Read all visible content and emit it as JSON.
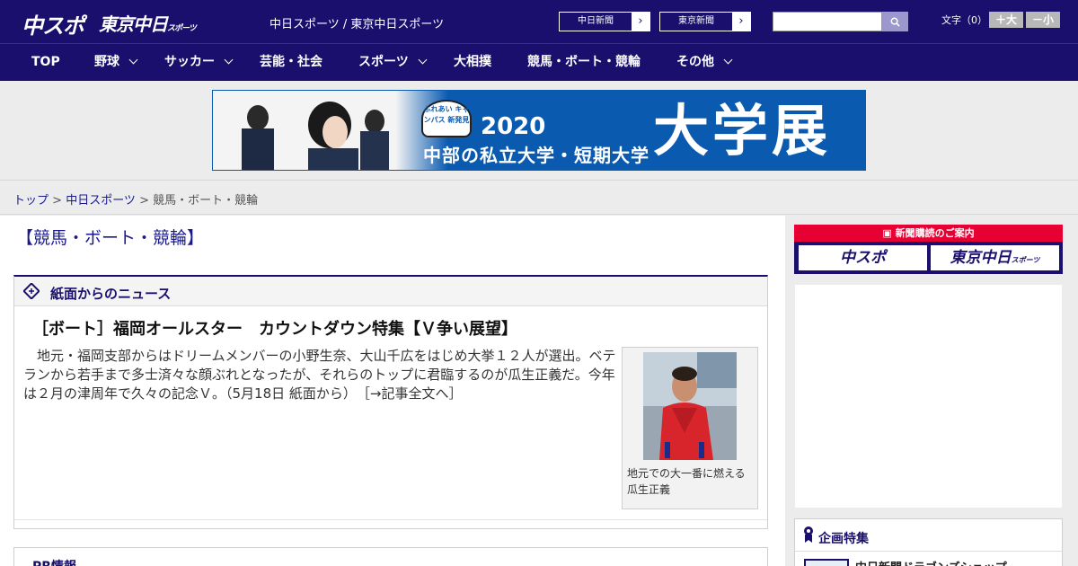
{
  "header": {
    "logo_chuspo": "中スポ",
    "logo_tokyo": "東京中日",
    "logo_tokyo_small": "スポーツ",
    "site_links": "中日スポーツ / 東京中日スポーツ",
    "paper_a": "中日新聞",
    "paper_b": "東京新聞",
    "arrow": "›",
    "search": {
      "value": "",
      "placeholder": ""
    },
    "moji_label": "文字（0）",
    "size_plus": "＋大",
    "size_minus": "－小"
  },
  "nav": {
    "items": [
      {
        "label": "TOP",
        "dropdown": false
      },
      {
        "label": "野球",
        "dropdown": true
      },
      {
        "label": "サッカー",
        "dropdown": true
      },
      {
        "label": "芸能・社会",
        "dropdown": false
      },
      {
        "label": "スポーツ",
        "dropdown": true
      },
      {
        "label": "大相撲",
        "dropdown": false
      },
      {
        "label": "競馬・ボート・競輪",
        "dropdown": false
      },
      {
        "label": "その他",
        "dropdown": true
      }
    ]
  },
  "banner": {
    "badge": "ふれあい キャンパス 新発見",
    "year": "2020",
    "subtitle": "中部の私立大学・短期大学",
    "big": "大学展"
  },
  "breadcrumb": {
    "home": "トップ",
    "sep": " > ",
    "section": "中日スポーツ",
    "current": "競馬・ボート・競輪"
  },
  "page": {
    "title": "【競馬・ボート・競輪】"
  },
  "news": {
    "heading": "紙面からのニュース",
    "article_title": "［ボート］福岡オールスター　カウントダウン特集【Ｖ争い展望】",
    "body": "地元・福岡支部からはドリームメンバーの小野生奈、大山千広をはじめ大挙１２人が選出。ベテランから若手まで多士済々な顔ぶれとなったが、それらのトップに君臨するのが瓜生正義だ。今年は２月の津周年で久々の記念Ｖ。（5月18日 紙面から）",
    "more_link": "［→記事全文へ］",
    "photo_caption": "地元での大一番に燃える瓜生正義"
  },
  "pr": {
    "heading": "PR情報"
  },
  "sidebar": {
    "subscribe_header": "新聞購読のご案内",
    "subscribe_a": "中スポ",
    "subscribe_b": "東京中日",
    "subscribe_b_small": "スポーツ",
    "feature_heading": "企画特集",
    "feature_item": "中日新聞ドラゴンズショップ"
  },
  "colors": {
    "brand_navy": "#1a0f6d",
    "accent_red": "#e60033",
    "link_blue": "#1a1a8f"
  }
}
